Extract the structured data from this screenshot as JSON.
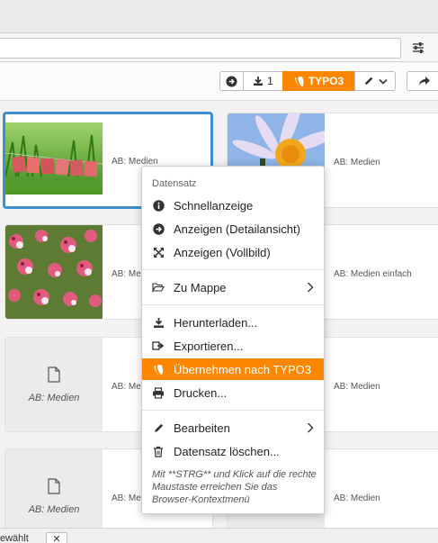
{
  "toolbar": {
    "download_count": "1",
    "typo3_label": "TYPO3"
  },
  "cards": [
    {
      "label": "AB: Medien",
      "thumb": "sommer-photo"
    },
    {
      "label": "AB: Medien",
      "thumb": "daisy-photo"
    },
    {
      "label": "AB: Medien",
      "thumb": "flowers-photo"
    },
    {
      "label": "AB: Medien einfach",
      "thumb": "none"
    },
    {
      "label": "AB: Medien",
      "thumb_label": "AB: Medien"
    },
    {
      "label": "AB: Medien",
      "thumb": "none"
    },
    {
      "label": "AB: Medien",
      "thumb_label": "AB: Medien"
    },
    {
      "label": "AB: Medien",
      "thumb": "none"
    }
  ],
  "context_menu": {
    "header": "Datensatz",
    "items": {
      "quick_view": "Schnellanzeige",
      "detail_view": "Anzeigen (Detailansicht)",
      "fullscreen": "Anzeigen (Vollbild)",
      "to_folder": "Zu Mappe",
      "download": "Herunterladen...",
      "export": "Exportieren...",
      "transfer_typo3": "Übernehmen nach TYPO3",
      "print": "Drucken...",
      "edit": "Bearbeiten",
      "delete": "Datensatz löschen..."
    },
    "hint": "Mit **STRG** und Klick auf die rechte Maustaste erreichen Sie das Browser-Kontextmenü"
  },
  "statusbar": {
    "text": "ewählt",
    "close": "✕"
  },
  "colors": {
    "accent": "#ff8700",
    "selection": "#3c8fd1"
  }
}
